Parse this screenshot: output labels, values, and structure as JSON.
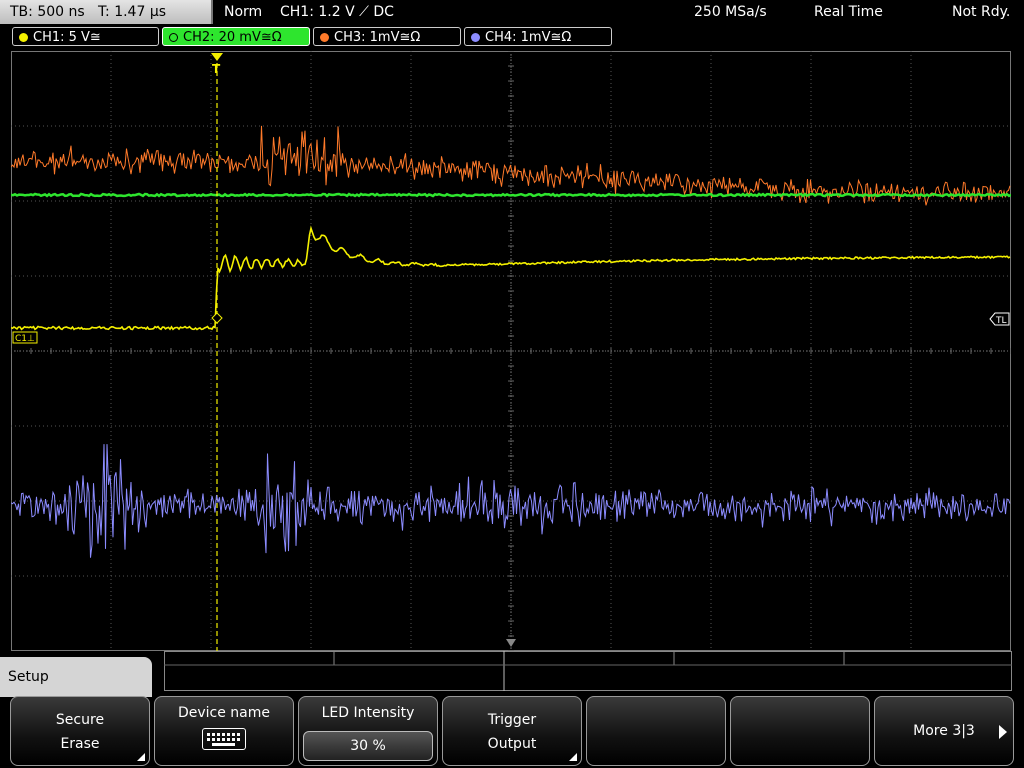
{
  "status": {
    "timebase": "TB: 500 ns   T: 1.47 µs",
    "mode": "Norm",
    "trigger": "CH1: 1.2 V ⟋ DC",
    "sample_rate": "250 MSa/s",
    "acq_mode": "Real Time",
    "run_state": "Not Rdy."
  },
  "channels": [
    {
      "label": "CH1: 5 V≅",
      "color": "#f4f000",
      "active": false
    },
    {
      "label": "CH2: 20 mV≅Ω",
      "color": "#2ee52e",
      "active": true
    },
    {
      "label": "CH3: 1mV≅Ω",
      "color": "#ff8c2a",
      "active": false
    },
    {
      "label": "CH4: 1mV≅Ω",
      "color": "#8c8cff",
      "active": false
    }
  ],
  "markers": {
    "ch1_ref": "C1⊥",
    "trigger_level": "TL",
    "trigger_pos": "T"
  },
  "menu": {
    "title": "Setup",
    "softkeys": [
      {
        "line1": "Secure",
        "line2": "Erase"
      },
      {
        "line1": "Device name",
        "icon": "keyboard-icon"
      },
      {
        "line1": "LED Intensity",
        "value": "30 %"
      },
      {
        "line1": "Trigger",
        "line2": "Output"
      },
      {
        "line1": ""
      },
      {
        "line1": ""
      },
      {
        "line1": "More 3|3"
      }
    ]
  },
  "colors": {
    "ch1": "#f4f000",
    "ch2": "#2ee52e",
    "ch3": "#ff7a2a",
    "ch4": "#8c8cff",
    "grid": "#555555"
  }
}
